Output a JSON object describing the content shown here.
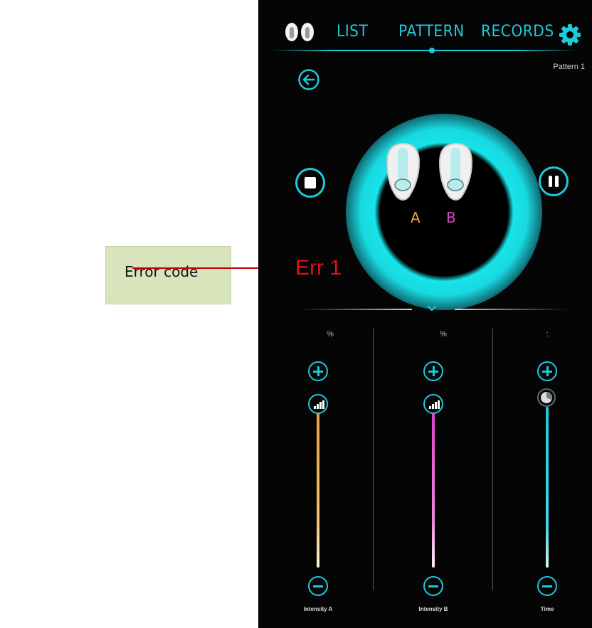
{
  "annotation": {
    "callout_text": "Error code",
    "callout_color": "#d8e4bc",
    "line_color": "#c00000"
  },
  "app": {
    "accent_color": "#1ec9dc",
    "nav": {
      "tabs": [
        "LIST",
        "PATTERN",
        "RECORDS"
      ],
      "active_tab": "PATTERN"
    },
    "pattern_name": "Pattern  1",
    "device": {
      "label_a": "A",
      "label_b": "B",
      "color_a": "#e8a23a",
      "color_b": "#e040c8"
    },
    "error_text": "Err 1",
    "error_color": "#e0101a",
    "controls": [
      {
        "unit": "%",
        "label": "Intensity A",
        "track_color": "#e8a23a",
        "icon": "signal-bars-icon"
      },
      {
        "unit": "%",
        "label": "Intensity B",
        "track_color": "#e040c8",
        "icon": "signal-bars-icon"
      },
      {
        "unit": ":",
        "label": "Time",
        "track_color": "#1ec9dc",
        "icon": "clock-icon"
      }
    ]
  }
}
